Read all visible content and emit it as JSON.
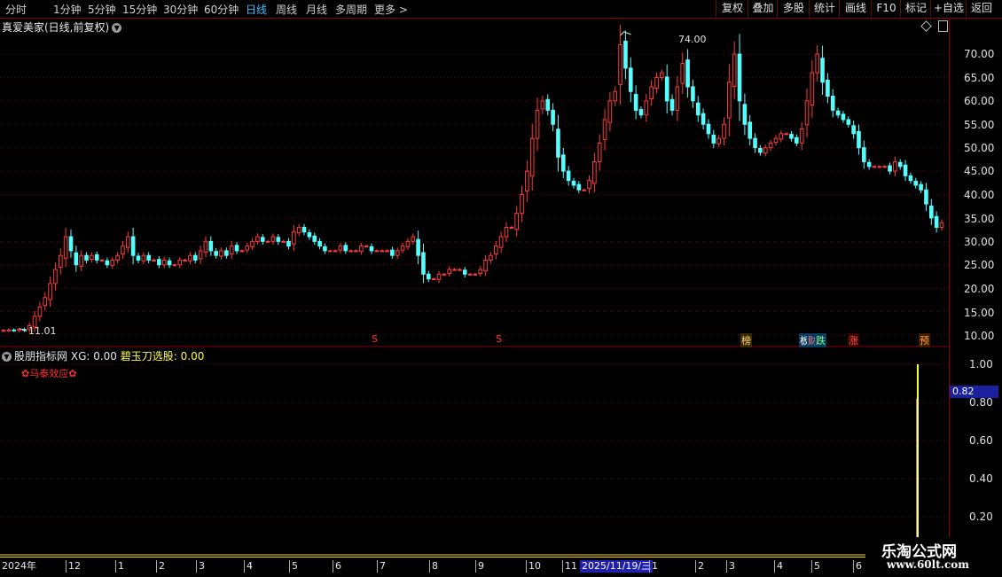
{
  "toolbar": {
    "periods": [
      "分时",
      "1分钟",
      "5分钟",
      "15分钟",
      "30分钟",
      "60分钟",
      "日线",
      "周线",
      "月线",
      "多周期",
      "更多 >"
    ],
    "buttons": [
      "复权",
      "叠加",
      "多股",
      "统计",
      "画线",
      "F10",
      "标记",
      "+自选",
      "返回"
    ]
  },
  "chart": {
    "title": "真爱美家(日线,前复权)",
    "high_label": "74.00",
    "low_label": "11.01",
    "price_axis": [
      "70.00",
      "65.00",
      "60.00",
      "55.00",
      "50.00",
      "45.00",
      "40.00",
      "35.00",
      "30.00",
      "25.00",
      "20.00",
      "15.00",
      "10.00"
    ],
    "signals": [
      {
        "text": "S",
        "color": "#ff3030"
      },
      {
        "text": "S",
        "color": "#ff3030"
      },
      {
        "text": "榜",
        "color": "#ffd27a"
      },
      {
        "text": "板",
        "color": "#ffffff"
      },
      {
        "text": "财",
        "color": "#ff8080"
      },
      {
        "text": "跌",
        "color": "#80ff80"
      },
      {
        "text": "涨",
        "color": "#ff5050"
      },
      {
        "text": "预",
        "color": "#ffa040"
      }
    ]
  },
  "indicator": {
    "name": "股朋指标网",
    "xg": "XG: 0.00",
    "label2": "碧玉刀选股:",
    "val2": "0.00",
    "subtitle": "✿马泰效应✿",
    "axis": [
      "1.00",
      "0.80",
      "0.60",
      "0.40",
      "0.20"
    ],
    "current_value": "0.82"
  },
  "time_axis": {
    "year": "2024年",
    "months": [
      "12",
      "1",
      "2",
      "3",
      "4",
      "5",
      "6",
      "7",
      "8",
      "9",
      "10",
      "11",
      "1",
      "2",
      "3",
      "4",
      "5",
      "6"
    ],
    "selected_date": "2025/11/19/三"
  },
  "watermark": {
    "title": "乐淘公式网",
    "url": "www.60lt.com"
  },
  "colors": {
    "up": "#ff3a3a",
    "down": "#54ffff",
    "bg": "#000000",
    "grid": "#8b0000",
    "indicator_line": "#ffff40"
  },
  "chart_data": {
    "type": "candlestick",
    "title": "真爱美家(日线,前复权)",
    "ylim": [
      8,
      75
    ],
    "price_ticks": [
      10,
      15,
      20,
      25,
      30,
      35,
      40,
      45,
      50,
      55,
      60,
      65,
      70
    ],
    "x_axis_months": [
      "2024年",
      "12",
      "1",
      "2",
      "3",
      "4",
      "5",
      "6",
      "7",
      "8",
      "9",
      "10",
      "11",
      "2025/11/19/三",
      "1",
      "2",
      "3",
      "4",
      "5",
      "6"
    ],
    "close_series": [
      11.0,
      11.1,
      11.0,
      11.2,
      11.01,
      12,
      14,
      16,
      18,
      21,
      24,
      27,
      31,
      28,
      25,
      27,
      26,
      27,
      26,
      26,
      25,
      26,
      27,
      29,
      31,
      27,
      26,
      27,
      26,
      26,
      25,
      26,
      25,
      25,
      26,
      26,
      27,
      26,
      28,
      30,
      28,
      27,
      28,
      27,
      29,
      28,
      28,
      29,
      30,
      31,
      30,
      30,
      31,
      30,
      30,
      29,
      32,
      33,
      32,
      31,
      30,
      29,
      28,
      28,
      28,
      29,
      28,
      28,
      28,
      29,
      29,
      28,
      28,
      28,
      28,
      27,
      28,
      29,
      30,
      31,
      27,
      23,
      22,
      22,
      23,
      23,
      24,
      24,
      24,
      23,
      23,
      23,
      24,
      26,
      27,
      29,
      31,
      33,
      33,
      36,
      40,
      45,
      52,
      58,
      60,
      58,
      55,
      48,
      45,
      43,
      42,
      41,
      41,
      43,
      47,
      51,
      56,
      60,
      62,
      72,
      67,
      62,
      58,
      57,
      60,
      63,
      65,
      66,
      60,
      58,
      63,
      68,
      63,
      60,
      57,
      55,
      53,
      51,
      52,
      55,
      64,
      70,
      60,
      55,
      52,
      50,
      49,
      50,
      51,
      52,
      53,
      53,
      52,
      51,
      54,
      60,
      66,
      70,
      64,
      61,
      58,
      57,
      56,
      55,
      53,
      50,
      47,
      46,
      46,
      46,
      46,
      45,
      47,
      46,
      44,
      43,
      42,
      41,
      38,
      35,
      33,
      34
    ],
    "high": 74.0,
    "low": 11.01,
    "indicator": {
      "name": "股朋指标网",
      "XG": 0.0,
      "碧玉刀选股": 0.0,
      "ylim": [
        0,
        1.1
      ],
      "ticks": [
        0.2,
        0.4,
        0.6,
        0.8,
        1.0
      ],
      "spike_values": [
        1.0,
        0.82
      ],
      "current": 0.82
    }
  }
}
